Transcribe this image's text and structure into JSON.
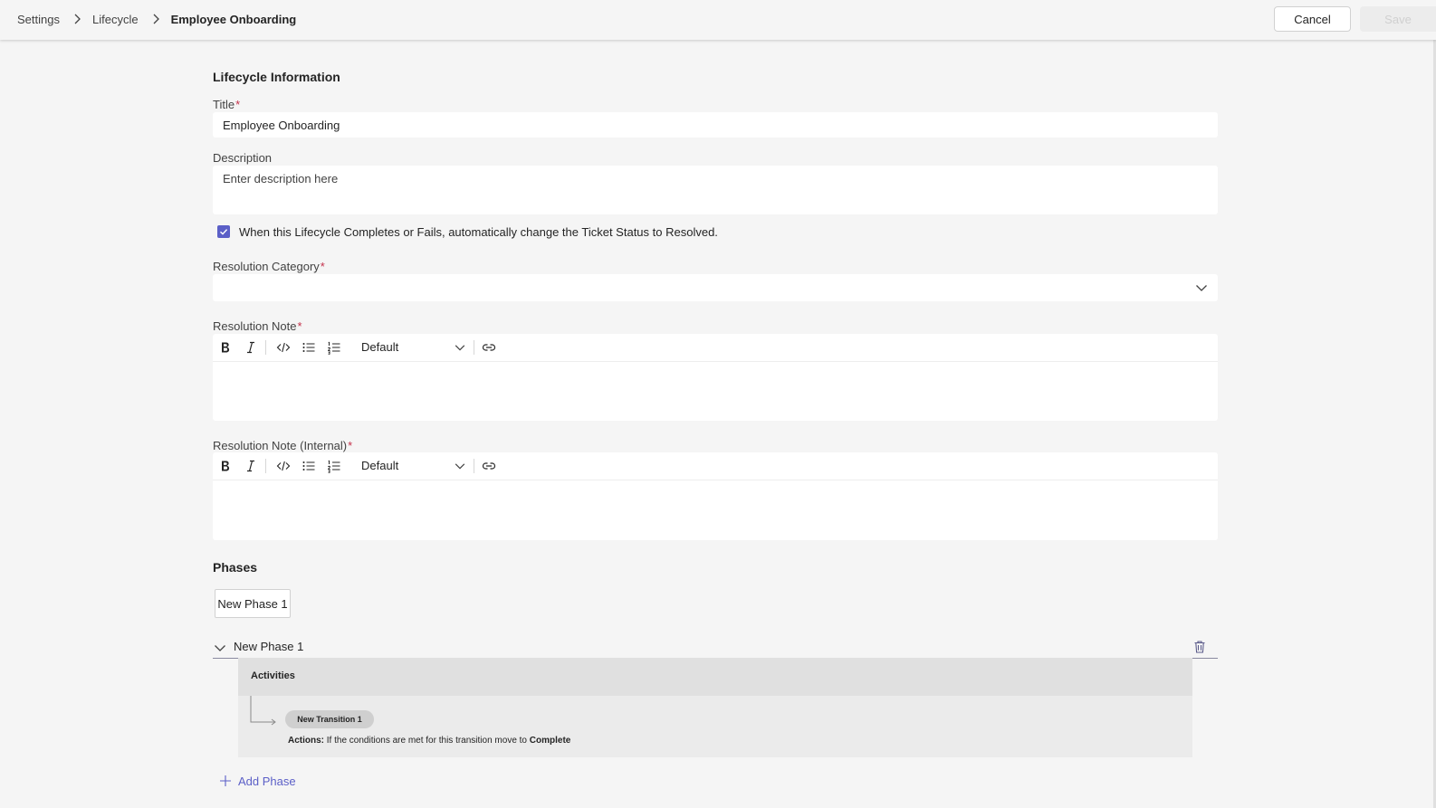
{
  "breadcrumb": {
    "items": [
      "Settings",
      "Lifecycle"
    ],
    "current": "Employee Onboarding"
  },
  "header": {
    "cancel_label": "Cancel",
    "save_label": "Save"
  },
  "form": {
    "section_title": "Lifecycle Information",
    "title_label": "Title",
    "title_value": "Employee Onboarding",
    "description_label": "Description",
    "description_placeholder": "Enter description here",
    "auto_resolve_checked": true,
    "auto_resolve_label": "When this Lifecycle Completes or Fails, automatically change the Ticket Status to Resolved.",
    "resolution_category_label": "Resolution Category",
    "resolution_category_value": "",
    "resolution_note_label": "Resolution Note",
    "resolution_note_internal_label": "Resolution Note (Internal)",
    "required_marker": "*"
  },
  "editor": {
    "style_option": "Default"
  },
  "phases": {
    "section_title": "Phases",
    "pills": [
      "New Phase 1"
    ],
    "expanded_phase": {
      "title": "New Phase 1",
      "activities_title": "Activities",
      "transition_label": "New Transition 1",
      "actions_prefix": "Actions:",
      "actions_text": "If the conditions are met for this transition move to",
      "actions_target": "Complete"
    },
    "add_phase_label": "Add Phase"
  },
  "colors": {
    "accent": "#5b5fc7",
    "required": "#c4314b",
    "background": "#f5f5f5"
  }
}
